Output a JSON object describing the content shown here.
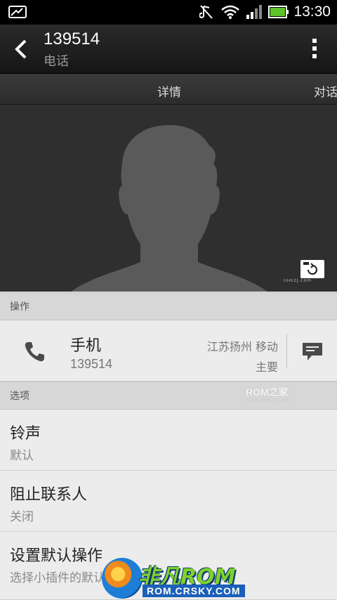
{
  "status_bar": {
    "time": "13:30",
    "icons": [
      "notification-icon",
      "mute-icon",
      "wifi-icon",
      "signal-icon",
      "battery-icon"
    ],
    "battery_color": "#5ec22b"
  },
  "action_bar": {
    "title": "139514",
    "subtitle": "电话",
    "back_icon": "chevron-left-icon",
    "menu_icon": "overflow-menu-icon"
  },
  "tabs": [
    {
      "label": "详情",
      "selected": true
    },
    {
      "label": "对话",
      "selected": false
    }
  ],
  "photo": {
    "placeholder": "contact-silhouette",
    "watermark": "romzj.com"
  },
  "sections": {
    "actions": "操作",
    "options": "选项"
  },
  "phone_entry": {
    "label": "手机",
    "number": "139514",
    "carrier": "江苏扬州 移动",
    "tag": "主要"
  },
  "options": [
    {
      "title": "铃声",
      "value": "默认"
    },
    {
      "title": "阻止联系人",
      "value": "关闭"
    },
    {
      "title": "设置默认操作",
      "value": "选择小插件的默认"
    }
  ],
  "watermarks": {
    "romzj": "ROM之家",
    "romzj_url": "www.romzj.com",
    "feifan_brand": "非凡ROM",
    "feifan_url": "ROM.CRSKY.COM"
  }
}
